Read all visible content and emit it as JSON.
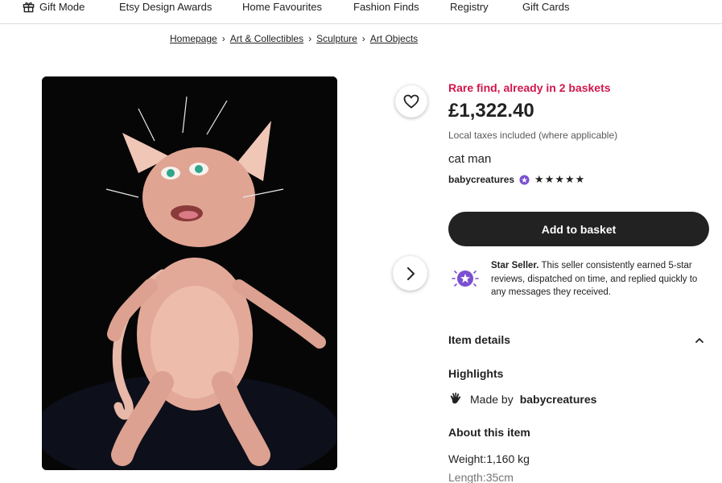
{
  "nav": {
    "items": [
      "Gift Mode",
      "Etsy Design Awards",
      "Home Favourites",
      "Fashion Finds",
      "Registry",
      "Gift Cards"
    ]
  },
  "breadcrumb": [
    "Homepage",
    "Art & Collectibles",
    "Sculpture",
    "Art Objects"
  ],
  "listing": {
    "rare_notice": "Rare find, already in 2 baskets",
    "price": "£1,322.40",
    "taxes_note": "Local taxes included (where applicable)",
    "title": "cat man",
    "shop_name": "babycreatures",
    "rating_stars": "★★★★★",
    "add_to_basket": "Add to basket"
  },
  "star_seller": {
    "label": "Star Seller.",
    "description": " This seller consistently earned 5-star reviews, dispatched on time, and replied quickly to any messages they received."
  },
  "details": {
    "section_title": "Item details",
    "highlights_title": "Highlights",
    "made_by_prefix": "Made by",
    "made_by_shop": "babycreatures",
    "about_title": "About this item",
    "weight": "Weight:1,160 kg",
    "length": "Length:35cm"
  },
  "colors": {
    "accent_red": "#d1164e",
    "button_dark": "#222222",
    "star_seller_purple": "#7b4fd0"
  },
  "icons": {
    "gift": "gift-icon",
    "favourite": "heart-icon",
    "next": "chevron-right-icon",
    "star_seller": "star-seller-badge-icon",
    "collapse": "chevron-up-icon",
    "handmade": "hand-icon"
  }
}
